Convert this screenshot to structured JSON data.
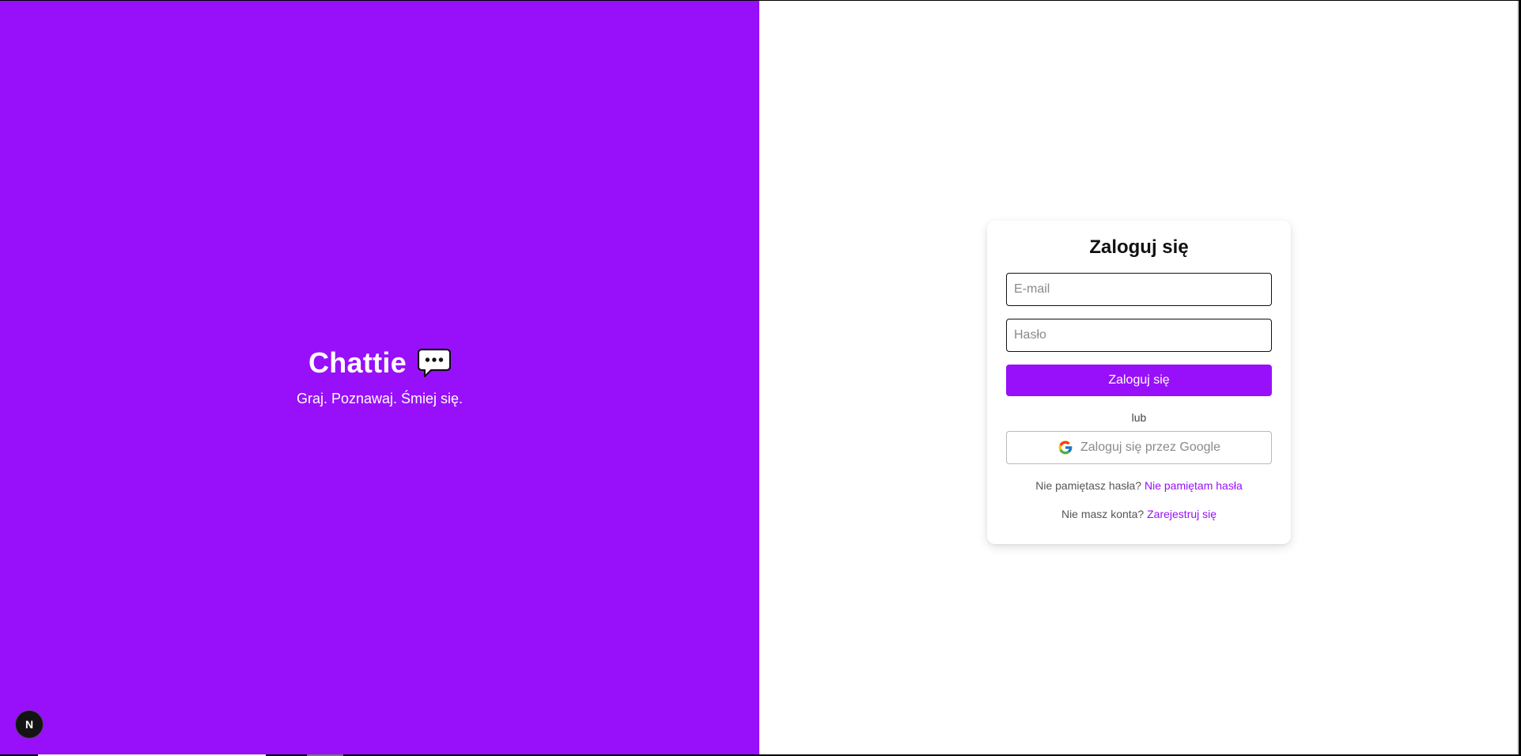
{
  "hero": {
    "brand_name": "Chattie",
    "brand_icon": "speech-bubble-icon",
    "tagline": "Graj. Poznawaj. Śmiej się.",
    "background_color": "#9810fa"
  },
  "dev_badge": {
    "label": "N",
    "icon": "nextjs-icon"
  },
  "login_form": {
    "title": "Zaloguj się",
    "email_placeholder": "E-mail",
    "password_placeholder": "Hasło",
    "submit_label": "Zaloguj się",
    "divider": "lub",
    "google_label": "Zaloguj się przez Google",
    "google_icon": "google-icon",
    "forgot_prompt": "Nie pamiętasz hasła?",
    "forgot_link": "Nie pamiętam hasła",
    "register_prompt": "Nie masz konta?",
    "register_link": "Zarejestruj się",
    "accent_color": "#9810fa"
  }
}
